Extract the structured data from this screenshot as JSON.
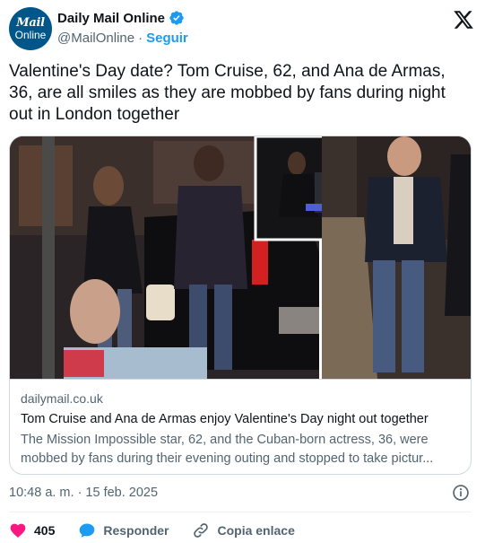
{
  "header": {
    "avatar_line1": "Mail",
    "avatar_line2": "Online",
    "name": "Daily Mail Online",
    "handle": "@MailOnline",
    "separator": "·",
    "follow_label": "Seguir"
  },
  "tweet": {
    "text": "Valentine's Day date? Tom Cruise, 62, and Ana de Armas, 36, are all smiles as they are mobbed by fans during night out in London together"
  },
  "card": {
    "domain": "dailymail.co.uk",
    "title": "Tom Cruise and Ana de Armas enjoy Valentine's Day night out together",
    "description": "The Mission Impossible star, 62, and the Cuban-born actress, 36, were mobbed by fans during their evening outing and stopped to take pictur..."
  },
  "timestamp": "10:48 a. m. · 15 feb. 2025",
  "actions": {
    "likes": "405",
    "reply_label": "Responder",
    "copy_link_label": "Copia enlace"
  },
  "colors": {
    "accent": "#1d9bf0",
    "like": "#f91880",
    "text": "#0f1419",
    "muted": "#536471",
    "brand": "#005689"
  }
}
